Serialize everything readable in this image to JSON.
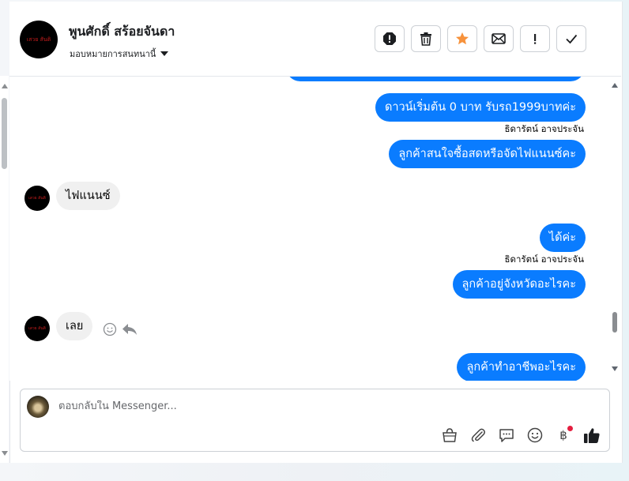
{
  "header": {
    "contact_name": "พูนศักดิ์ สร้อยจันดา",
    "assign_label": "มอบหมายการสนทนานี้",
    "avatar_text": "เสวย สันติ"
  },
  "actions": [
    {
      "name": "spam-report-button",
      "icon": "alert-octagon-icon"
    },
    {
      "name": "delete-button",
      "icon": "trash-icon"
    },
    {
      "name": "star-button",
      "icon": "star-icon",
      "color": "#f7923b"
    },
    {
      "name": "mark-unread-button",
      "icon": "envelope-icon"
    },
    {
      "name": "follow-up-button",
      "icon": "exclamation-icon"
    },
    {
      "name": "mark-done-button",
      "icon": "check-icon"
    }
  ],
  "messages": [
    {
      "dir": "out",
      "text": "ดาวน์เริ่มต้น 0 บาท รับรถ1999บาทค่ะ"
    },
    {
      "dir": "sender",
      "text": "ธิดารัตน์ อาจประจัน"
    },
    {
      "dir": "out",
      "text": "ลูกค้าสนใจซื้อสดหรือจัดไฟแนนซ์คะ"
    },
    {
      "dir": "in",
      "text": "ไฟแนนซ์"
    },
    {
      "dir": "out",
      "text": "ได้ค่ะ"
    },
    {
      "dir": "sender",
      "text": "ธิดารัตน์ อาจประจัน"
    },
    {
      "dir": "out",
      "text": "ลูกค้าอยู่จังหวัดอะไรคะ"
    },
    {
      "dir": "in",
      "text": "เลย"
    },
    {
      "dir": "out",
      "text": "ลูกค้าทำอาชีพอะไรคะ"
    }
  ],
  "composer": {
    "placeholder": "ตอบกลับใน Messenger...",
    "tools": [
      "bag-icon",
      "paperclip-icon",
      "chat-icon",
      "smiley-icon",
      "baht-icon",
      "thumbs-up-icon"
    ],
    "baht_symbol": "฿"
  },
  "colors": {
    "outgoing_bubble": "#0a7cff",
    "incoming_bubble": "#f0f0f0",
    "star": "#f7923b",
    "notification_dot": "#e41e3f"
  }
}
